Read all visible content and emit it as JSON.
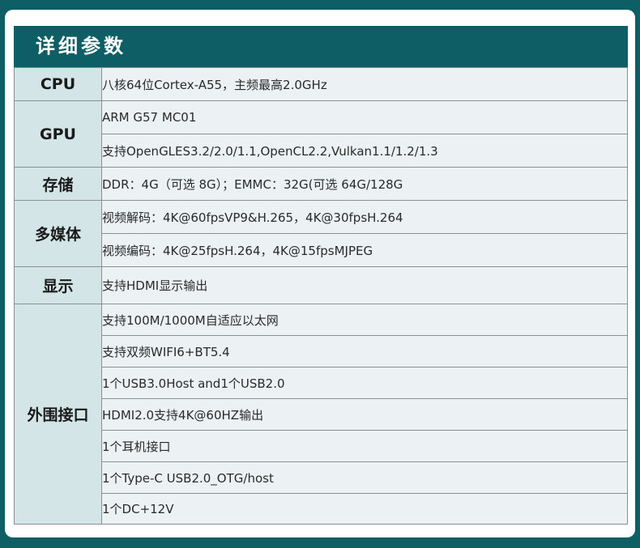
{
  "title": "详细参数",
  "sections": [
    {
      "category": "CPU",
      "values": [
        "八核64位Cortex-A55，主频最高2.0GHz"
      ]
    },
    {
      "category": "GPU",
      "values": [
        "ARM G57 MC01",
        "支持OpenGLES3.2/2.0/1.1,OpenCL2.2,Vulkan1.1/1.2/1.3"
      ]
    },
    {
      "category": "存储",
      "values": [
        "DDR：4G（可选 8G）；EMMC：32G(可选 64G/128G"
      ]
    },
    {
      "category": "多媒体",
      "values": [
        "视频解码：4K@60fpsVP9&H.265，4K@30fpsH.264",
        "视频编码：4K@25fpsH.264，4K@15fpsMJPEG"
      ]
    },
    {
      "category": "显示",
      "values": [
        "支持HDMI显示输出"
      ]
    },
    {
      "category": "外围接口",
      "values": [
        "支持100M/1000M自适应以太网",
        "支持双频WIFI6+BT5.4",
        "1个USB3.0Host and1个USB2.0",
        "HDMI2.0支持4K@60HZ输出",
        "1个耳机接口",
        "1个Type-C USB2.0_OTG/host",
        "1个DC+12V"
      ]
    }
  ]
}
